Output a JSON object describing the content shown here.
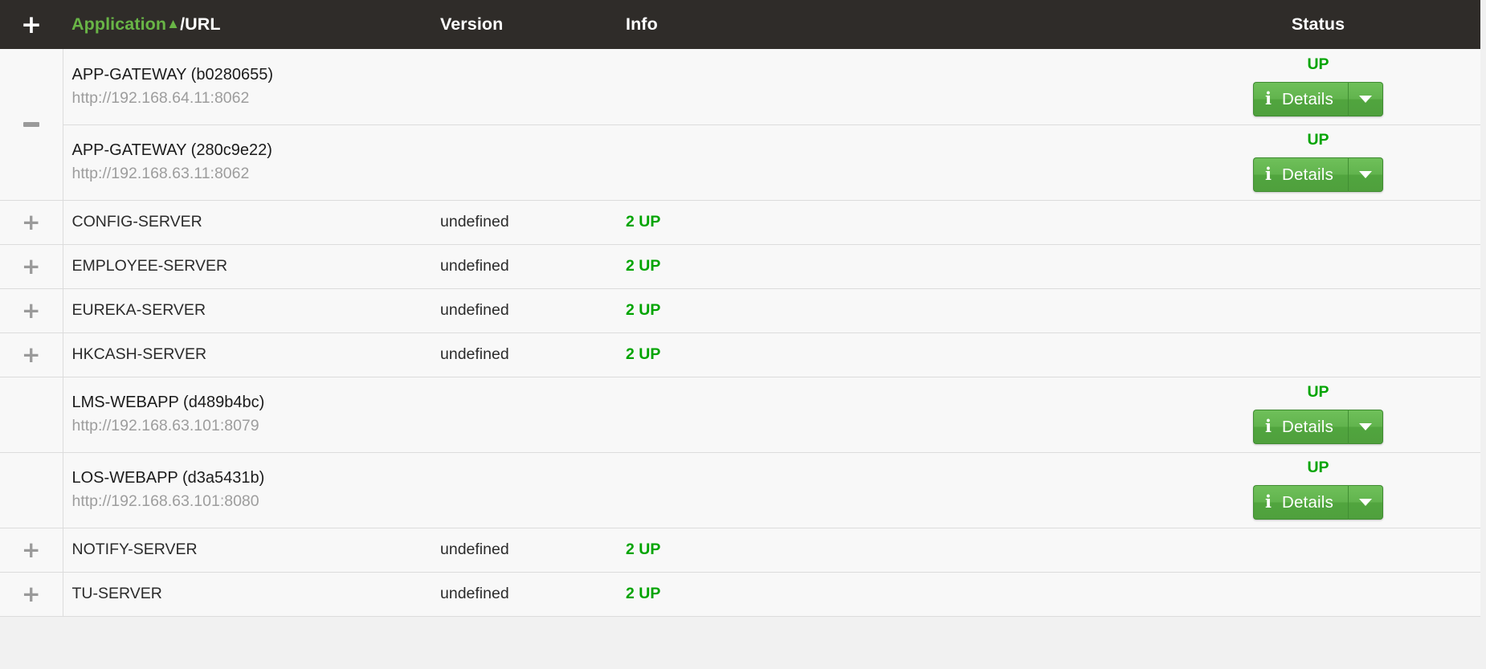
{
  "table": {
    "columns": {
      "toggle_icon": "+",
      "application_label": "Application",
      "sort_caret": "▲",
      "separator": "/",
      "url_label": "URL",
      "version_label": "Version",
      "info_label": "Info",
      "status_label": "Status"
    },
    "button": {
      "info_icon": "i",
      "details_label": "Details",
      "caret_icon": "▼"
    },
    "icons": {
      "expand": "+",
      "collapse": "−"
    },
    "colors": {
      "header_bg": "#2f2c29",
      "accent_green": "#69b546",
      "status_green": "#00a400",
      "button_green": "#62b44e",
      "row_bg": "#f8f8f8",
      "border": "#dcdcdc",
      "url_gray": "#9d9d9d",
      "page_bg": "#f1f1f1"
    },
    "groups": [
      {
        "toggle": "collapse",
        "instances": [
          {
            "name": "APP-GATEWAY (b0280655)",
            "url": "http://192.168.64.11:8062",
            "version": "",
            "info": "",
            "status": "UP",
            "has_details_button": true
          },
          {
            "name": "APP-GATEWAY (280c9e22)",
            "url": "http://192.168.63.11:8062",
            "version": "",
            "info": "",
            "status": "UP",
            "has_details_button": true
          }
        ]
      },
      {
        "toggle": "expand",
        "instances": [
          {
            "name": "CONFIG-SERVER",
            "url": "",
            "version": "undefined",
            "info": "2 UP",
            "status": "",
            "has_details_button": false
          }
        ]
      },
      {
        "toggle": "expand",
        "instances": [
          {
            "name": "EMPLOYEE-SERVER",
            "url": "",
            "version": "undefined",
            "info": "2 UP",
            "status": "",
            "has_details_button": false
          }
        ]
      },
      {
        "toggle": "expand",
        "instances": [
          {
            "name": "EUREKA-SERVER",
            "url": "",
            "version": "undefined",
            "info": "2 UP",
            "status": "",
            "has_details_button": false
          }
        ]
      },
      {
        "toggle": "expand",
        "instances": [
          {
            "name": "HKCASH-SERVER",
            "url": "",
            "version": "undefined",
            "info": "2 UP",
            "status": "",
            "has_details_button": false
          }
        ]
      },
      {
        "toggle": "none",
        "instances": [
          {
            "name": "LMS-WEBAPP (d489b4bc)",
            "url": "http://192.168.63.101:8079",
            "version": "",
            "info": "",
            "status": "UP",
            "has_details_button": true
          }
        ]
      },
      {
        "toggle": "none",
        "instances": [
          {
            "name": "LOS-WEBAPP (d3a5431b)",
            "url": "http://192.168.63.101:8080",
            "version": "",
            "info": "",
            "status": "UP",
            "has_details_button": true
          }
        ]
      },
      {
        "toggle": "expand",
        "instances": [
          {
            "name": "NOTIFY-SERVER",
            "url": "",
            "version": "undefined",
            "info": "2 UP",
            "status": "",
            "has_details_button": false
          }
        ]
      },
      {
        "toggle": "expand",
        "instances": [
          {
            "name": "TU-SERVER",
            "url": "",
            "version": "undefined",
            "info": "2 UP",
            "status": "",
            "has_details_button": false
          }
        ]
      }
    ]
  }
}
